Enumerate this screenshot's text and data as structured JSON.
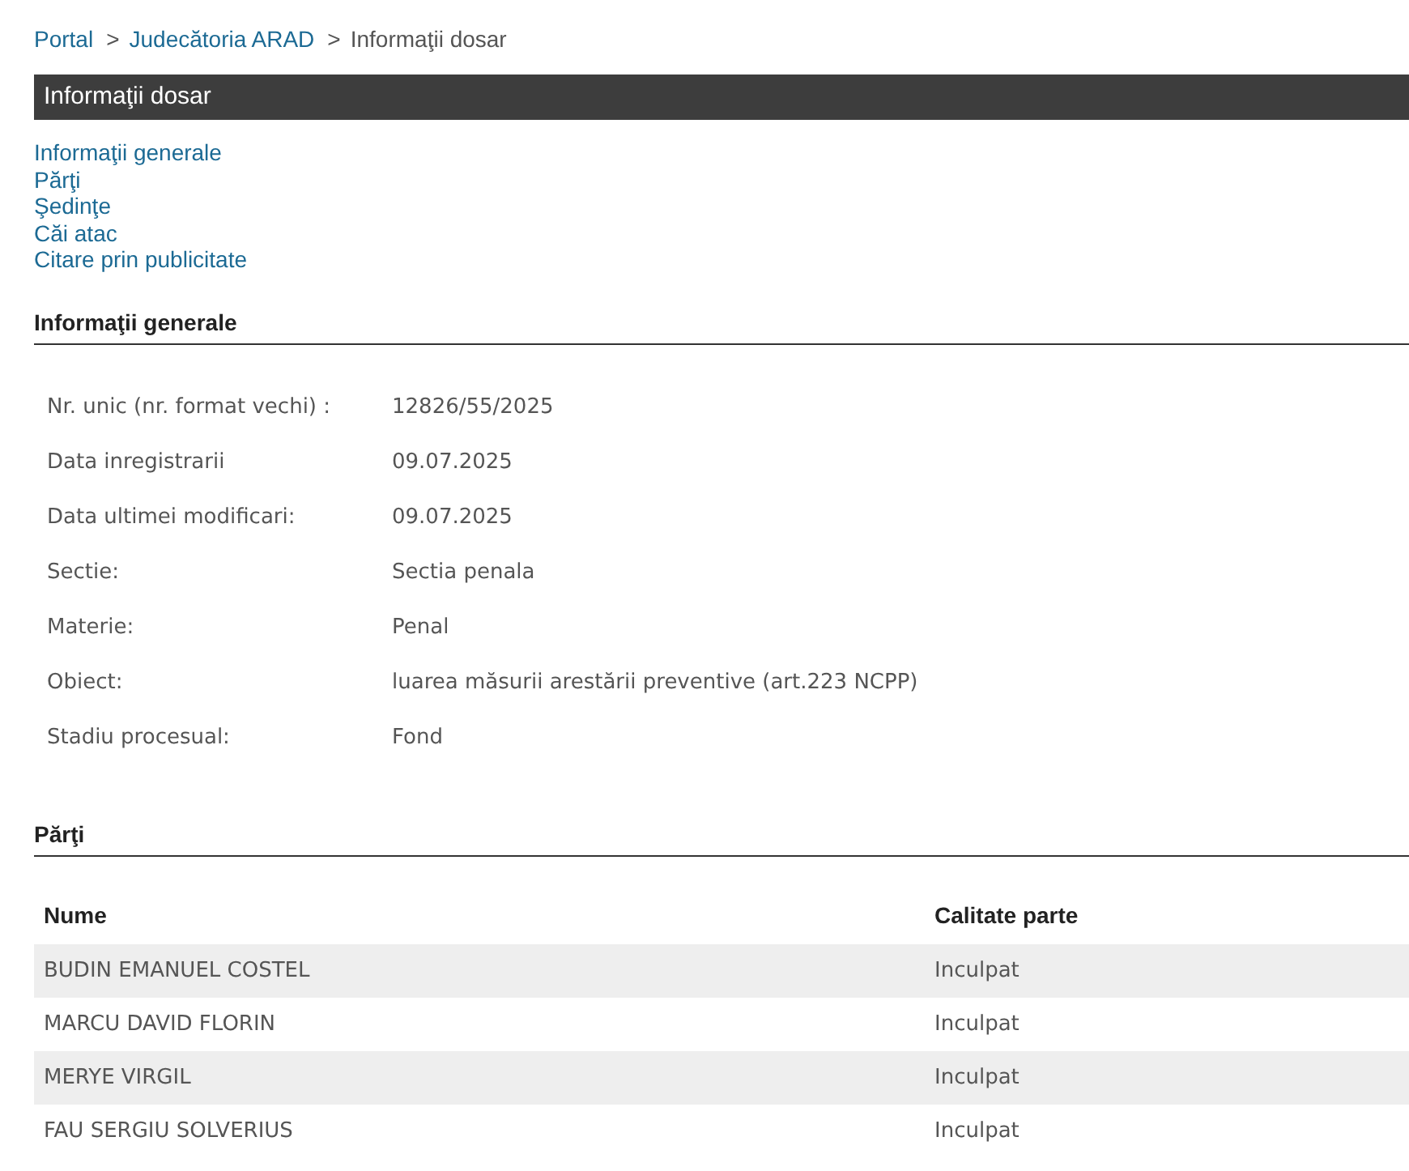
{
  "breadcrumb": [
    {
      "kind": "link",
      "text": "Portal"
    },
    {
      "kind": "separator",
      "text": ">"
    },
    {
      "kind": "link",
      "text": "Judecătoria ARAD"
    },
    {
      "kind": "separator",
      "text": ">"
    },
    {
      "kind": "current",
      "text": "Informaţii dosar"
    }
  ],
  "header": {
    "title": "Informaţii dosar"
  },
  "nav_links": [
    "Informaţii generale",
    "Părţi",
    "Şedinţe",
    "Căi atac",
    "Citare prin publicitate"
  ],
  "general_info": {
    "title": "Informaţii generale",
    "fields": [
      {
        "label": "Nr. unic (nr. format vechi) :",
        "value": "12826/55/2025"
      },
      {
        "label": "Data inregistrarii",
        "value": "09.07.2025"
      },
      {
        "label": "Data ultimei modificari:",
        "value": "09.07.2025"
      },
      {
        "label": "Sectie:",
        "value": "Sectia penala"
      },
      {
        "label": "Materie:",
        "value": "Penal"
      },
      {
        "label": "Obiect:",
        "value": "luarea măsurii arestării preventive (art.223 NCPP)"
      },
      {
        "label": "Stadiu procesual:",
        "value": "Fond"
      }
    ]
  },
  "parties": {
    "title": "Părţi",
    "columns": [
      "Nume",
      "Calitate parte"
    ],
    "rows": [
      [
        "BUDIN EMANUEL COSTEL",
        "Inculpat"
      ],
      [
        "MARCU DAVID FLORIN",
        "Inculpat"
      ],
      [
        "MERYE VIRGIL",
        "Inculpat"
      ],
      [
        "FAU SERGIU SOLVERIUS",
        "Inculpat"
      ]
    ]
  }
}
